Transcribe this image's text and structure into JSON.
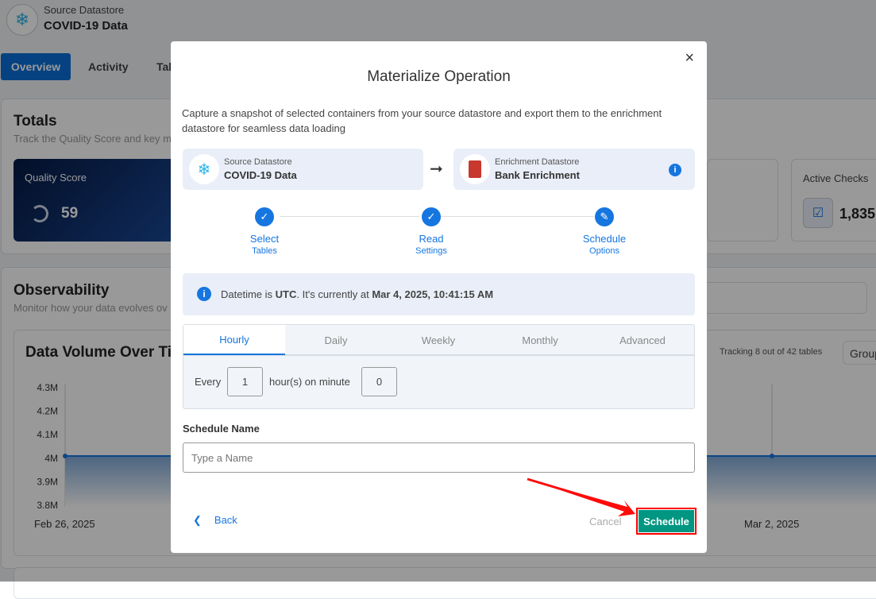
{
  "background": {
    "datastore_label": "Source Datastore",
    "datastore_name": "COVID-19 Data",
    "tabs": [
      "Overview",
      "Activity",
      "Tab"
    ],
    "totals_title": "Totals",
    "totals_sub": "Track the Quality Score and key m",
    "quality_label": "Quality Score",
    "quality_value": "59",
    "active_checks_label": "Active Checks",
    "active_checks_value": "1,835",
    "obs_title": "Observability",
    "obs_sub": "Monitor how your data evolves ov",
    "chart_title": "Data Volume Over Tim",
    "tracking": "Tracking 8 out of 42 tables",
    "group": "Group",
    "y_ticks": [
      "4.3M",
      "4.2M",
      "4.1M",
      "4M",
      "3.9M",
      "3.8M"
    ],
    "x_labels": [
      "Feb 26, 2025",
      "Mar 2, 2025"
    ]
  },
  "modal": {
    "title": "Materialize Operation",
    "close": "×",
    "description": "Capture a snapshot of selected containers from your source datastore and export them to the enrichment datastore for seamless data loading",
    "source": {
      "label": "Source Datastore",
      "name": "COVID-19 Data"
    },
    "enrichment": {
      "label": "Enrichment Datastore",
      "name": "Bank Enrichment"
    },
    "steps": [
      {
        "title": "Select",
        "sub": "Tables",
        "state": "done"
      },
      {
        "title": "Read",
        "sub": "Settings",
        "state": "done"
      },
      {
        "title": "Schedule",
        "sub": "Options",
        "state": "current"
      }
    ],
    "info": {
      "pre": "Datetime is ",
      "tz": "UTC",
      "mid": ". It's currently at ",
      "now": "Mar 4, 2025, 10:41:15 AM"
    },
    "tabs": [
      "Hourly",
      "Daily",
      "Weekly",
      "Monthly",
      "Advanced"
    ],
    "active_tab": "Hourly",
    "every_label": "Every",
    "every_value": "1",
    "hours_label": "hour(s) on minute",
    "minute_value": "0",
    "schedule_name_label": "Schedule Name",
    "schedule_name_placeholder": "Type a Name",
    "schedule_name_value": "",
    "back": "Back",
    "cancel": "Cancel",
    "schedule": "Schedule"
  },
  "colors": {
    "primary": "#1676e0",
    "schedule_button": "#009682",
    "highlight": "#ff0000"
  }
}
